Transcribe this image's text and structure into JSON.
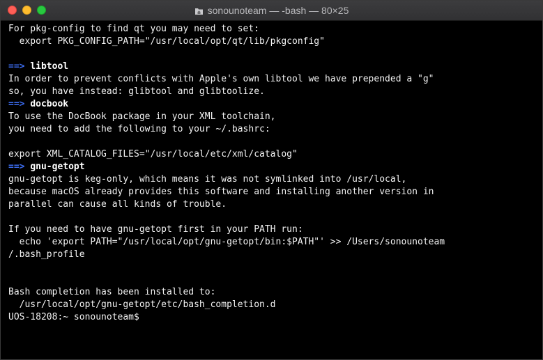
{
  "window": {
    "title": "sonounoteam — -bash — 80×25",
    "icon": "home-folder-icon"
  },
  "terminal": {
    "lines": [
      {
        "text": "For pkg-config to find qt you may need to set:"
      },
      {
        "text": "  export PKG_CONFIG_PATH=\"/usr/local/opt/qt/lib/pkgconfig\""
      },
      {
        "text": ""
      },
      {
        "arrow": "==>",
        "pkg": "libtool"
      },
      {
        "text": "In order to prevent conflicts with Apple's own libtool we have prepended a \"g\""
      },
      {
        "text": "so, you have instead: glibtool and glibtoolize."
      },
      {
        "arrow": "==>",
        "pkg": "docbook"
      },
      {
        "text": "To use the DocBook package in your XML toolchain,"
      },
      {
        "text": "you need to add the following to your ~/.bashrc:"
      },
      {
        "text": ""
      },
      {
        "text": "export XML_CATALOG_FILES=\"/usr/local/etc/xml/catalog\""
      },
      {
        "arrow": "==>",
        "pkg": "gnu-getopt"
      },
      {
        "text": "gnu-getopt is keg-only, which means it was not symlinked into /usr/local,"
      },
      {
        "text": "because macOS already provides this software and installing another version in"
      },
      {
        "text": "parallel can cause all kinds of trouble."
      },
      {
        "text": ""
      },
      {
        "text": "If you need to have gnu-getopt first in your PATH run:"
      },
      {
        "text": "  echo 'export PATH=\"/usr/local/opt/gnu-getopt/bin:$PATH\"' >> /Users/sonounoteam"
      },
      {
        "text": "/.bash_profile"
      },
      {
        "text": ""
      },
      {
        "text": ""
      },
      {
        "text": "Bash completion has been installed to:"
      },
      {
        "text": "  /usr/local/opt/gnu-getopt/etc/bash_completion.d"
      },
      {
        "text": "UOS-18208:~ sonounoteam$ "
      }
    ]
  },
  "colors": {
    "background": "#000000",
    "text": "#f2f2f2",
    "arrow": "#3b6cf0"
  }
}
